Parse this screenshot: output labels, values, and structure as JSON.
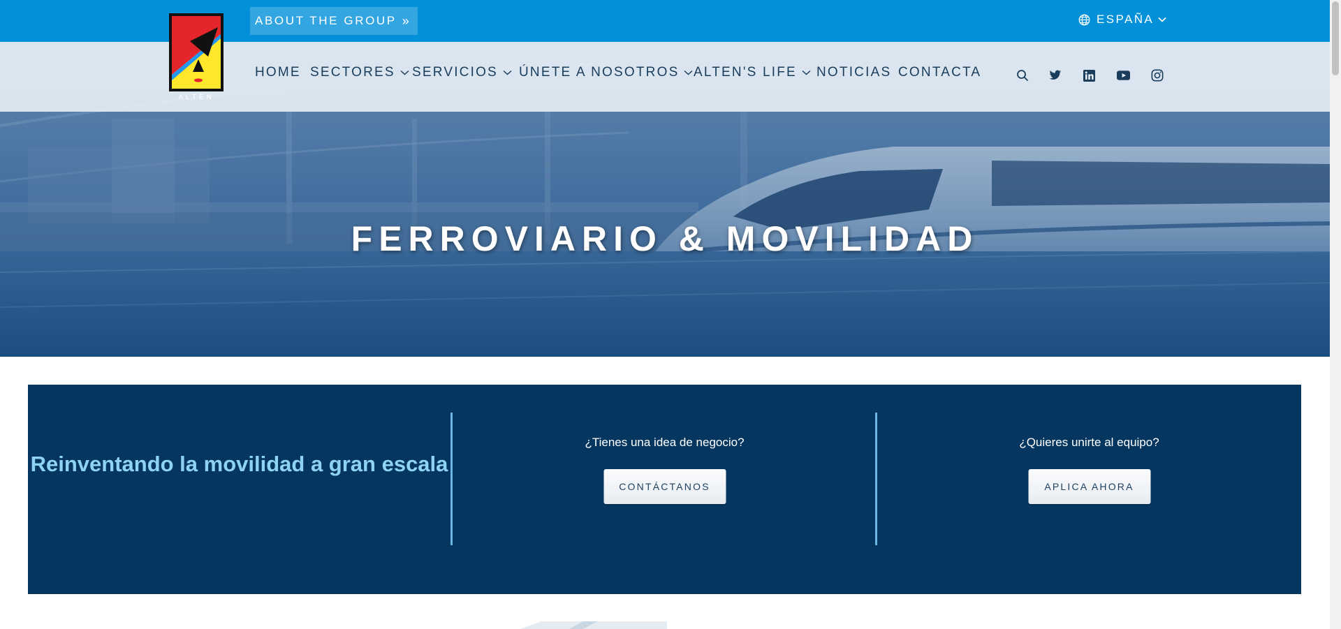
{
  "topbar": {
    "about_label": "ABOUT THE GROUP",
    "about_chevron": "»",
    "language_label": "ESPAÑA"
  },
  "brand": {
    "logo_text": "ALTEN",
    "colors": {
      "blue": "#0290d8",
      "navy": "#04365f",
      "red": "#e3262b",
      "yellow": "#ffe72c"
    }
  },
  "nav": {
    "items": [
      {
        "label": "HOME",
        "has_dropdown": false
      },
      {
        "label": "SECTORES",
        "has_dropdown": true
      },
      {
        "label": "SERVICIOS",
        "has_dropdown": true
      },
      {
        "label": "ÚNETE A NOSOTROS",
        "has_dropdown": true
      },
      {
        "label": "ALTEN'S LIFE",
        "has_dropdown": true
      },
      {
        "label": "NOTICIAS",
        "has_dropdown": false
      },
      {
        "label": "CONTACTA",
        "has_dropdown": false
      }
    ],
    "icons": [
      "search-icon",
      "twitter-icon",
      "linkedin-icon",
      "youtube-icon",
      "instagram-icon"
    ]
  },
  "hero": {
    "title": "FERROVIARIO & MOVILIDAD"
  },
  "cta": {
    "headline": "Reinventando la movilidad a gran escala",
    "col1_question": "¿Tienes una idea de negocio?",
    "col1_button": "CONTÁCTANOS",
    "col2_question": "¿Quieres unirte al equipo?",
    "col2_button": "APLICA AHORA"
  }
}
